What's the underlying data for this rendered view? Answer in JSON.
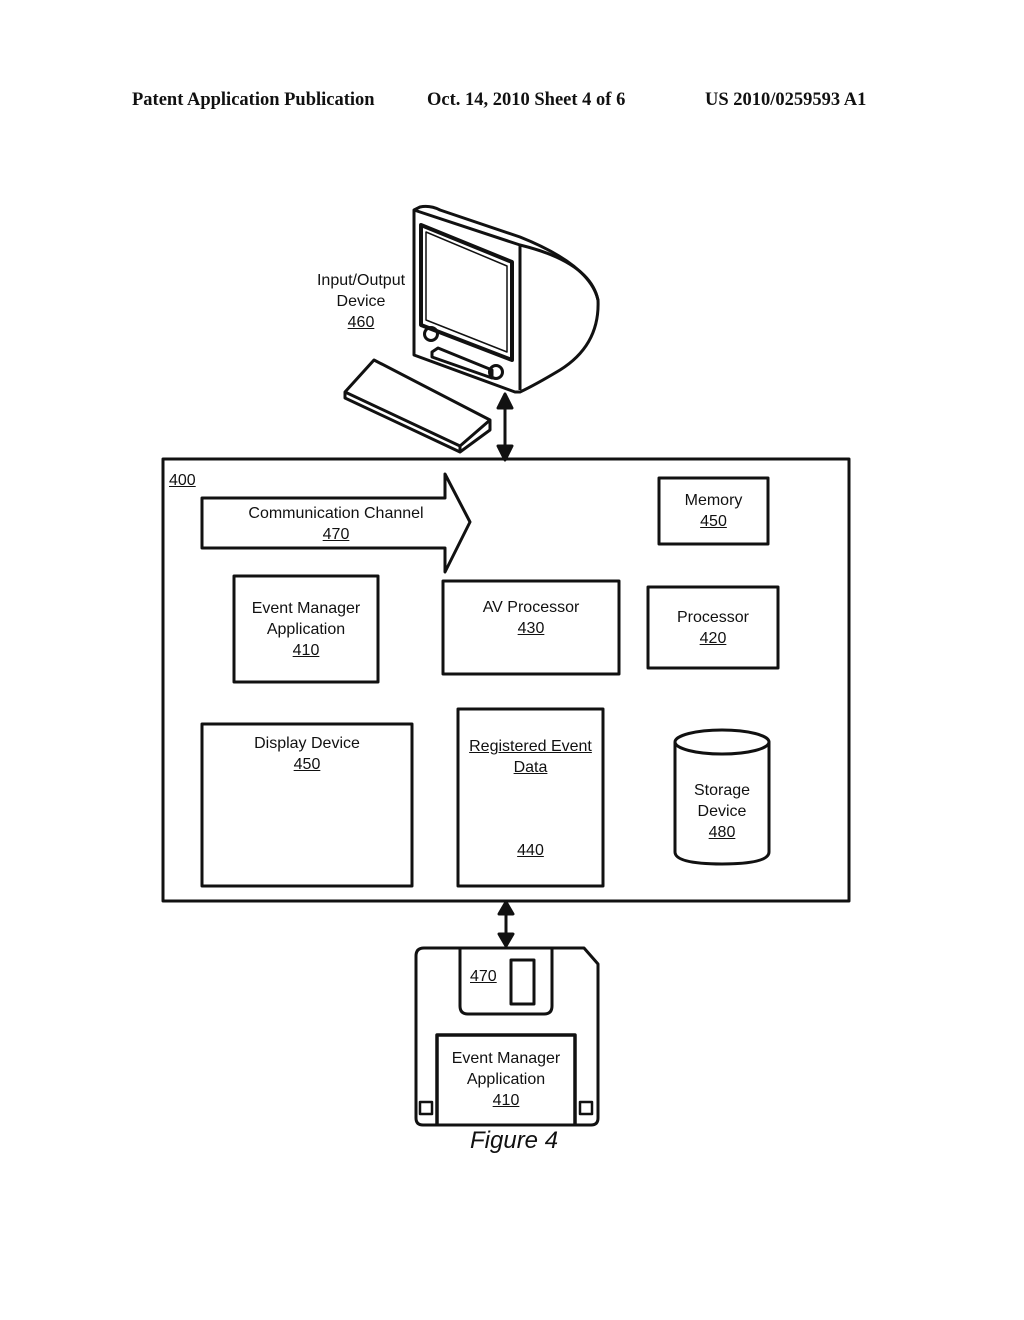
{
  "header": {
    "publication": "Patent Application Publication",
    "date_sheet": "Oct. 14, 2010   Sheet 4 of 6",
    "number": "US 2010/0259593 A1"
  },
  "io_device": {
    "title_line1": "Input/Output",
    "title_line2": "Device",
    "ref": "460"
  },
  "system": {
    "ref": "400"
  },
  "comm_channel": {
    "title": "Communication Channel",
    "ref": "470"
  },
  "memory": {
    "title": "Memory",
    "ref": "450"
  },
  "event_manager": {
    "title_line1": "Event Manager",
    "title_line2": "Application",
    "ref": "410"
  },
  "av_processor": {
    "title": "AV Processor",
    "ref": "430"
  },
  "processor": {
    "title": "Processor",
    "ref": "420"
  },
  "display_device": {
    "title": "Display Device",
    "ref": "450"
  },
  "registered_event": {
    "title_line1": "Registered Event",
    "title_line2": "Data",
    "ref": "440"
  },
  "storage": {
    "title_line1": "Storage",
    "title_line2": "Device",
    "ref": "480"
  },
  "floppy": {
    "shutter_ref": "470",
    "label_line1": "Event Manager",
    "label_line2": "Application",
    "label_ref": "410"
  },
  "figure_caption": "Figure 4"
}
